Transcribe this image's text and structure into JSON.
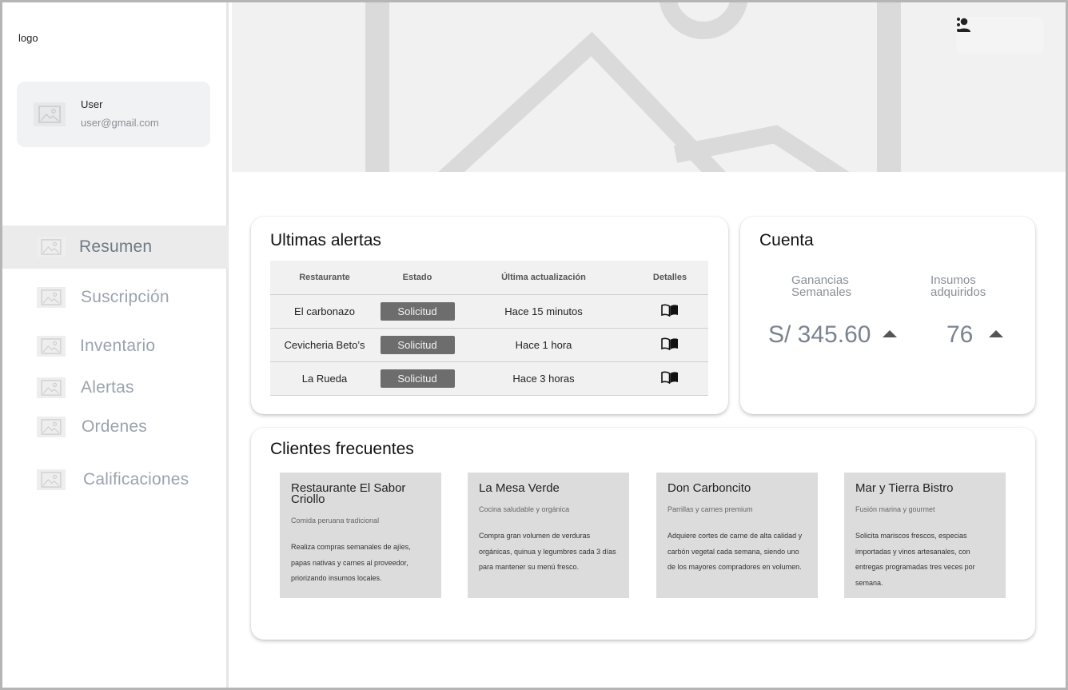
{
  "sidebar": {
    "logo": "logo",
    "user": {
      "name": "User",
      "email": "user@gmail.com"
    },
    "nav": [
      {
        "label": "Resumen",
        "active": true
      },
      {
        "label": "Suscripción",
        "active": false
      },
      {
        "label": "Inventario",
        "active": false
      },
      {
        "label": "Alertas",
        "active": false
      },
      {
        "label": "Ordenes",
        "active": false
      },
      {
        "label": "Calificaciones",
        "active": false
      }
    ]
  },
  "topbar": {
    "icons": [
      "person-icon",
      "more-vert-icon"
    ]
  },
  "alerts": {
    "title": "Ultimas alertas",
    "columns": [
      "Restaurante",
      "Estado",
      "Última actualización",
      "Detalles"
    ],
    "rows": [
      {
        "restaurant": "El carbonazo",
        "status": "Solicitud",
        "updated": "Hace 15 minutos"
      },
      {
        "restaurant": "Cevicheria Beto’s",
        "status": "Solicitud",
        "updated": "Hace 1 hora"
      },
      {
        "restaurant": "La Rueda",
        "status": "Solicitud",
        "updated": "Hace 3 horas"
      }
    ]
  },
  "account": {
    "title": "Cuenta",
    "earnings": {
      "label_line1": "Ganancias",
      "label_line2": "Semanales",
      "value": "S/ 345.60"
    },
    "supplies": {
      "label_line1": "Insumos",
      "label_line2": "adquiridos",
      "value": "76"
    }
  },
  "clients": {
    "title": "Clientes frecuentes",
    "items": [
      {
        "name": "Restaurante El Sabor Criollo",
        "subtitle": "Comida peruana tradicional",
        "description": "Realiza compras semanales de ajíes, papas nativas y carnes al proveedor, priorizando insumos locales."
      },
      {
        "name": "La Mesa Verde",
        "subtitle": "Cocina saludable y orgánica",
        "description": "Compra gran volumen de verduras orgánicas, quinua y legumbres cada 3 días para mantener su menú fresco."
      },
      {
        "name": "Don Carboncito",
        "subtitle": "Parrillas y carnes premium",
        "description": "Adquiere cortes de carne de alta calidad y carbón vegetal cada semana, siendo uno de los mayores compradores en volumen."
      },
      {
        "name": "Mar y Tierra Bistro",
        "subtitle": "Fusión marina y gourmet",
        "description": "Solicita mariscos frescos, especias importadas y vinos artesanales, con entregas programadas tres veces por semana."
      }
    ]
  },
  "colors": {
    "accent_gray": "#6d6d6d",
    "card_gray": "#dcdcdc",
    "muted_text": "#9aa3ae"
  }
}
